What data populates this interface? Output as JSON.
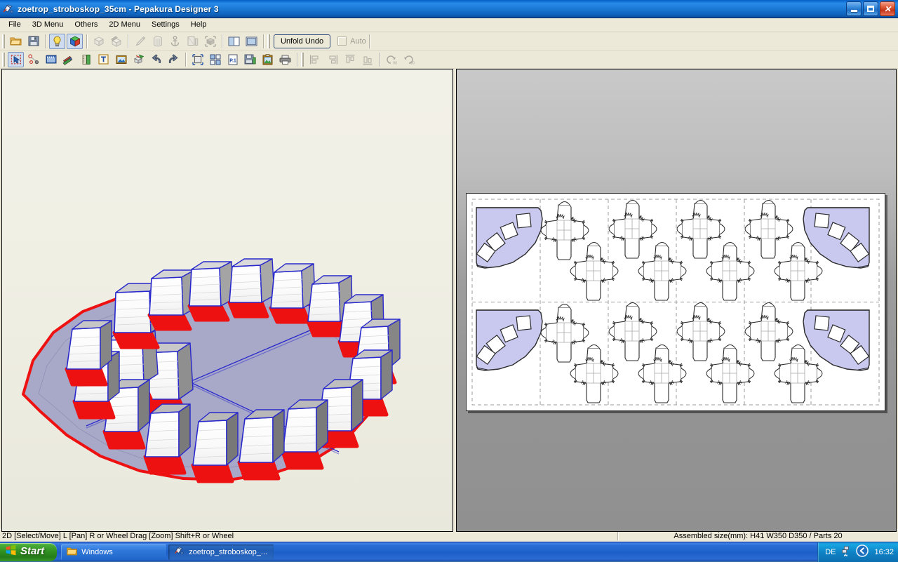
{
  "window": {
    "title": "zoetrop_stroboskop_35cm - Pepakura Designer 3",
    "icon": "pepakura-app-icon",
    "buttons": {
      "minimize": "minimize-icon",
      "maximize": "maximize-icon",
      "close": "close-icon"
    }
  },
  "menubar": {
    "items": [
      {
        "label": "File"
      },
      {
        "label": "3D Menu"
      },
      {
        "label": "Others"
      },
      {
        "label": "2D Menu"
      },
      {
        "label": "Settings"
      },
      {
        "label": "Help"
      }
    ]
  },
  "toolbar_row1": {
    "buttons": [
      {
        "name": "open-file-button",
        "icon": "folder-open-icon",
        "state": "enabled"
      },
      {
        "name": "save-file-button",
        "icon": "floppy-save-icon",
        "state": "enabled"
      },
      {
        "name": "lighting-toggle-button",
        "icon": "lightbulb-icon",
        "state": "pressed"
      },
      {
        "name": "texture-toggle-button",
        "icon": "color-cube-icon",
        "state": "pressed"
      },
      {
        "name": "flat-shading-button",
        "icon": "white-cube-icon",
        "state": "disabled"
      },
      {
        "name": "edge-paint-button",
        "icon": "cube-pencil-icon",
        "state": "disabled"
      },
      {
        "name": "edit-flaps-button",
        "icon": "pencil-icon",
        "state": "disabled"
      },
      {
        "name": "cylinder-tool-button",
        "icon": "cylinder-icon",
        "state": "disabled"
      },
      {
        "name": "anchor-tool-button",
        "icon": "anchor-icon",
        "state": "disabled"
      },
      {
        "name": "texture-panel-button",
        "icon": "texture-panel-icon",
        "state": "disabled"
      },
      {
        "name": "select-mesh-button",
        "icon": "select-cube-icon",
        "state": "disabled"
      },
      {
        "name": "split-view-h-button",
        "icon": "split-view-vertical-icon",
        "state": "enabled"
      },
      {
        "name": "split-view-v-button",
        "icon": "split-view-single-icon",
        "state": "enabled"
      }
    ],
    "unfold_undo_label": "Unfold Undo",
    "auto_label": "Auto",
    "auto_checked": false,
    "auto_enabled": false
  },
  "toolbar_row2": {
    "buttons": [
      {
        "name": "select-move-tool-button",
        "icon": "arrow-select-icon",
        "state": "pressed"
      },
      {
        "name": "join-divide-face-button",
        "icon": "join-divide-icon",
        "state": "enabled"
      },
      {
        "name": "edit-flap-tool-button",
        "icon": "flap-edit-icon",
        "state": "enabled"
      },
      {
        "name": "paint-lines-button",
        "icon": "colored-pencils-icon",
        "state": "enabled"
      },
      {
        "name": "measure-tool-button",
        "icon": "ruler-icon",
        "state": "enabled"
      },
      {
        "name": "add-text-button",
        "icon": "text-tool-icon",
        "state": "enabled"
      },
      {
        "name": "add-image-button",
        "icon": "image-tool-icon",
        "state": "enabled"
      },
      {
        "name": "unfold-tool-button",
        "icon": "unfold-cube-icon",
        "state": "enabled"
      },
      {
        "name": "undo-button",
        "icon": "undo-arrow-icon",
        "state": "enabled"
      },
      {
        "name": "redo-button",
        "icon": "redo-arrow-icon",
        "state": "enabled"
      },
      {
        "name": "page-layout-button",
        "icon": "page-select-icon",
        "state": "enabled"
      },
      {
        "name": "arrange-parts-button",
        "icon": "arrange-parts-icon",
        "state": "enabled"
      },
      {
        "name": "page-settings-button",
        "icon": "page-number-icon",
        "state": "enabled"
      },
      {
        "name": "export-image-button",
        "icon": "save-image-icon",
        "state": "enabled"
      },
      {
        "name": "copy-clipboard-button",
        "icon": "clipboard-icon",
        "state": "enabled"
      },
      {
        "name": "print-button",
        "icon": "printer-icon",
        "state": "enabled"
      },
      {
        "name": "align-left-button",
        "icon": "align-left-icon",
        "state": "disabled"
      },
      {
        "name": "align-right-button",
        "icon": "align-right-icon",
        "state": "disabled"
      },
      {
        "name": "align-top-button",
        "icon": "align-top-icon",
        "state": "disabled"
      },
      {
        "name": "align-bottom-button",
        "icon": "align-bottom-icon",
        "state": "disabled"
      },
      {
        "name": "rotate-left-90-button",
        "icon": "rotate-ccw-90-icon",
        "state": "disabled"
      },
      {
        "name": "rotate-right-90-button",
        "icon": "rotate-cw-90-icon",
        "state": "disabled"
      }
    ]
  },
  "panes": {
    "pane_3d": {
      "name": "3d-model-view",
      "background": "#fbfaf5"
    },
    "pane_2d": {
      "name": "2d-unfold-view",
      "background": "#9d9d9d"
    },
    "splitter": {
      "name": "pane-splitter"
    }
  },
  "model_3d": {
    "description": "zoetrope disc with 16 upright box figures arranged around the rim",
    "outline_color": "#ee1111",
    "fold_line_color": "#2222cc",
    "disc_fill": "#a8a8c8",
    "figure_count": 16,
    "diagonal_lines": 2
  },
  "unfold_2d": {
    "page_background": "#ffffff",
    "margin_guide_color": "#999999",
    "part_fill_highlight": "#c9c9f0",
    "cut_line_color": "#222222",
    "columns": 6,
    "rows": 2,
    "cells": [
      {
        "type": "quarter-disc",
        "mirrored": false,
        "cutouts": 4
      },
      {
        "type": "box-pair",
        "boxes": 2
      },
      {
        "type": "box-pair",
        "boxes": 2
      },
      {
        "type": "box-pair",
        "boxes": 2
      },
      {
        "type": "box-pair",
        "boxes": 2
      },
      {
        "type": "quarter-disc",
        "mirrored": true,
        "cutouts": 4
      },
      {
        "type": "quarter-disc",
        "mirrored": false,
        "cutouts": 4
      },
      {
        "type": "box-pair",
        "boxes": 2
      },
      {
        "type": "box-pair",
        "boxes": 2
      },
      {
        "type": "box-pair",
        "boxes": 2
      },
      {
        "type": "box-pair",
        "boxes": 2
      },
      {
        "type": "quarter-disc",
        "mirrored": true,
        "cutouts": 4
      }
    ]
  },
  "statusbar": {
    "left": "2D [Select/Move] L [Pan] R or Wheel Drag [Zoom] Shift+R or Wheel",
    "right": "Assembled size(mm): H41 W350 D350 / Parts 20"
  },
  "taskbar": {
    "start_label": "Start",
    "start_icon": "windows-flag-icon",
    "items": [
      {
        "label": "Windows",
        "icon": "folder-icon",
        "active": false
      },
      {
        "label": "zoetrop_stroboskop_...",
        "icon": "pepakura-app-icon",
        "active": true
      }
    ],
    "tray": {
      "language": "DE",
      "network_icon": "network-icon",
      "chevron_icon": "show-hidden-icons-icon",
      "clock": "16:32"
    }
  }
}
